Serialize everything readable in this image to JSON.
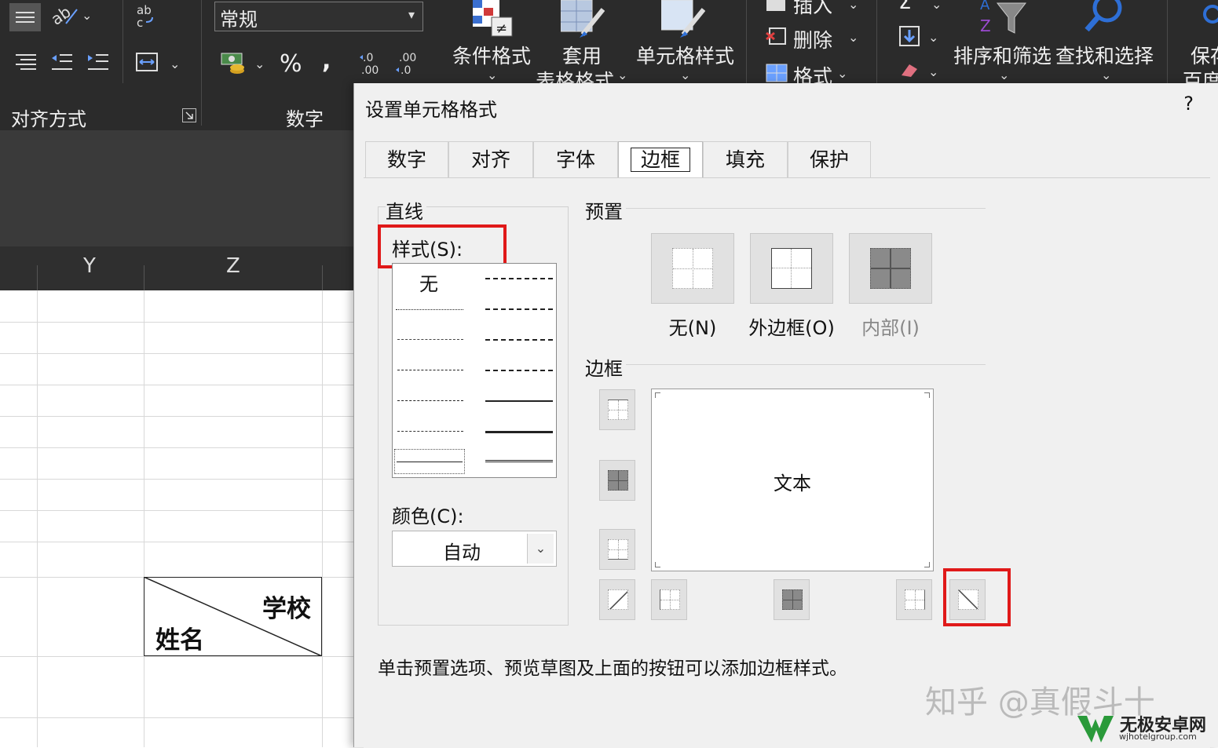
{
  "ribbon": {
    "number_format": "常规",
    "alignment_group": "对齐方式",
    "number_group": "数字",
    "percent": "%",
    "comma": ",",
    "increase_decimal": "←.0\n.00",
    "decrease_decimal": ".00\n→.0",
    "conditional_format": "条件格式",
    "table_format_1": "套用",
    "table_format_2": "表格格式",
    "cell_styles": "单元格样式",
    "insert": "插入",
    "delete": "删除",
    "format": "格式",
    "sort_filter": "排序和筛选",
    "find_select": "查找和选择",
    "save_1": "保存",
    "save_2": "百度"
  },
  "sheet": {
    "col_y": "Y",
    "col_z": "Z",
    "cell_top": "学校",
    "cell_bottom": "姓名"
  },
  "dialog": {
    "title": "设置单元格格式",
    "help": "?",
    "tabs": [
      "数字",
      "对齐",
      "字体",
      "边框",
      "填充",
      "保护"
    ],
    "active_tab": "边框",
    "line_group": "直线",
    "style_label": "样式(S):",
    "style_none": "无",
    "color_label": "颜色(C):",
    "color_value": "自动",
    "presets_group": "预置",
    "preset_none": "无(N)",
    "preset_outline": "外边框(O)",
    "preset_inside": "内部(I)",
    "border_group": "边框",
    "preview_text": "文本",
    "hint": "单击预置选项、预览草图及上面的按钮可以添加边框样式。"
  },
  "watermark": {
    "zhihu": "知乎 @真假斗十",
    "site": "无极安卓网",
    "url": "wjhotelgroup.com"
  },
  "colors": {
    "highlight": "#e01919",
    "ribbon_bg": "#2b2b2b",
    "dialog_bg": "#f0f0f0"
  }
}
